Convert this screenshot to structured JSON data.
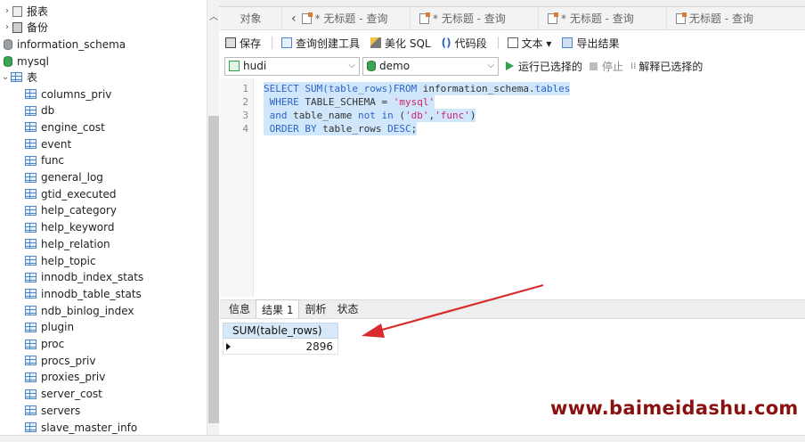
{
  "tree": {
    "reports_label": "报表",
    "backup_label": "备份",
    "db_information_schema": "information_schema",
    "db_mysql": "mysql",
    "tables_folder": "表",
    "tables": [
      "columns_priv",
      "db",
      "engine_cost",
      "event",
      "func",
      "general_log",
      "gtid_executed",
      "help_category",
      "help_keyword",
      "help_relation",
      "help_topic",
      "innodb_index_stats",
      "innodb_table_stats",
      "ndb_binlog_index",
      "plugin",
      "proc",
      "procs_priv",
      "proxies_priv",
      "server_cost",
      "servers",
      "slave_master_info"
    ]
  },
  "tabs": {
    "objects": "对象",
    "query_tabs": [
      "* 无标题 - 查询",
      "* 无标题 - 查询",
      "* 无标题 - 查询",
      "无标题 - 查询"
    ]
  },
  "toolbar": {
    "save": "保存",
    "query_builder": "查询创建工具",
    "beautify_sql": "美化 SQL",
    "code_snippet": "代码段",
    "text": "文本 ▾",
    "export": "导出结果"
  },
  "connection": {
    "connection_value": "hudi",
    "database_value": "demo",
    "run_selected": "运行已选择的",
    "stop": "停止",
    "explain_selected": "解释已选择的"
  },
  "editor": {
    "line_numbers": [
      "1",
      "2",
      "3",
      "4"
    ],
    "l1_a": "SELECT SUM(table_rows)FROM",
    "l1_b": " information_schema.",
    "l1_c": "tables",
    "l2_a": " WHERE",
    "l2_b": " TABLE_SCHEMA = ",
    "l2_c": "'mysql'",
    "l3_a": " and",
    "l3_b": " table_name ",
    "l3_c": "not in",
    "l3_d": " (",
    "l3_e": "'db'",
    "l3_f": ",",
    "l3_g": "'func'",
    "l3_h": ")",
    "l4_a": " ORDER BY",
    "l4_b": " table_rows ",
    "l4_c": "DESC",
    "l4_d": ";"
  },
  "results": {
    "tabs": [
      "信息",
      "结果 1",
      "剖析",
      "状态"
    ],
    "column_header": "SUM(table_rows)",
    "row_value": "2896"
  },
  "watermark": "www.baimeidashu.com",
  "colors": {
    "keyword": "#2f63c9",
    "string": "#d2236b",
    "selection": "#cfe6fb",
    "arrow": "#d92b2b",
    "watermark": "#8b1010"
  }
}
